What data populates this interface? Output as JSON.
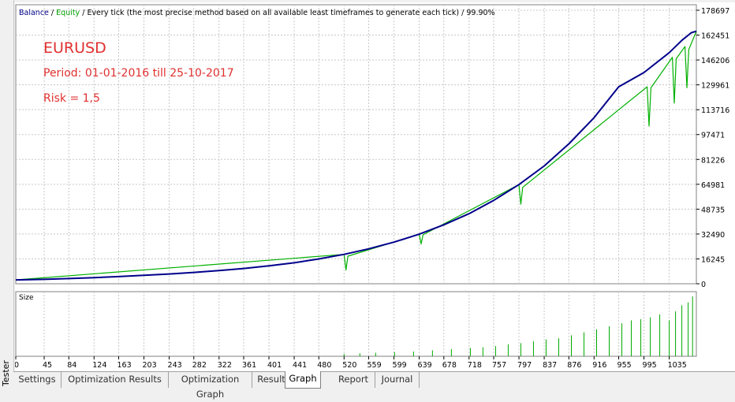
{
  "side_panel": {
    "label": "Tester"
  },
  "header": {
    "balance": "Balance",
    "sep1": " / ",
    "equity": "Equity",
    "sep2": " / ",
    "description": "Every tick (the most precise method based on all available least timeframes to generate each tick)",
    "sep3": " / ",
    "quality": "99.90%"
  },
  "annotations": {
    "symbol": "EURUSD",
    "period": "Period: 01-01-2016  till  25-10-2017",
    "risk": "Risk = 1,5"
  },
  "size_panel": {
    "label": "Size"
  },
  "tabs": [
    {
      "label": "Settings",
      "active": false
    },
    {
      "label": "Optimization Results",
      "active": false
    },
    {
      "label": "Optimization Graph",
      "active": false
    },
    {
      "label": "Results",
      "active": false
    },
    {
      "label": "Graph",
      "active": true
    },
    {
      "label": "Report",
      "active": false
    },
    {
      "label": "Journal",
      "active": false
    }
  ],
  "colors": {
    "balance": "#00008b",
    "equity": "#00b000",
    "annotation": "#e03030",
    "grid": "#c8c8c8",
    "size_bars": "#00aa00"
  },
  "chart_data": {
    "type": "line",
    "title": "",
    "xlabel": "",
    "ylabel": "",
    "x_ticks": [
      0,
      45,
      84,
      124,
      163,
      203,
      243,
      282,
      322,
      361,
      401,
      441,
      480,
      520,
      559,
      599,
      639,
      678,
      718,
      757,
      797,
      837,
      876,
      916,
      955,
      995,
      1035
    ],
    "y_ticks": [
      0,
      16245,
      32490,
      48735,
      64981,
      81226,
      97471,
      113716,
      129961,
      146206,
      162451,
      178697
    ],
    "xlim": [
      0,
      1078
    ],
    "ylim": [
      0,
      178697
    ],
    "grid": true,
    "series": [
      {
        "name": "Balance",
        "x": [
          0,
          45,
          84,
          124,
          163,
          203,
          243,
          282,
          322,
          361,
          401,
          441,
          480,
          520,
          559,
          599,
          639,
          678,
          718,
          757,
          797,
          837,
          876,
          916,
          955,
          995,
          1035,
          1055,
          1070,
          1078
        ],
        "values": [
          2500,
          2900,
          3400,
          4000,
          4700,
          5500,
          6400,
          7400,
          8600,
          10000,
          11700,
          13700,
          16200,
          19200,
          22800,
          27200,
          32400,
          38500,
          45800,
          54500,
          64800,
          77000,
          91400,
          108500,
          128700,
          138000,
          151000,
          159000,
          164000,
          165000
        ]
      },
      {
        "name": "Equity",
        "x": [
          0,
          520,
          523,
          526,
          639,
          642,
          645,
          797,
          800,
          803,
          1000,
          1003,
          1006,
          1040,
          1043,
          1046,
          1060,
          1063,
          1066,
          1078
        ],
        "values": [
          2500,
          19200,
          9000,
          18000,
          32400,
          26000,
          32000,
          64800,
          52000,
          63000,
          128700,
          103000,
          128000,
          148000,
          118000,
          147000,
          155000,
          128000,
          153000,
          165000
        ]
      }
    ],
    "size_series": {
      "name": "Size",
      "x": [
        520,
        545,
        570,
        600,
        630,
        660,
        690,
        720,
        740,
        760,
        780,
        800,
        820,
        840,
        860,
        880,
        900,
        920,
        940,
        960,
        975,
        990,
        1005,
        1020,
        1035,
        1045,
        1055,
        1065,
        1072
      ],
      "values": [
        0.04,
        0.05,
        0.06,
        0.07,
        0.08,
        0.1,
        0.12,
        0.14,
        0.15,
        0.17,
        0.2,
        0.22,
        0.25,
        0.28,
        0.3,
        0.35,
        0.4,
        0.45,
        0.5,
        0.55,
        0.6,
        0.62,
        0.65,
        0.7,
        0.6,
        0.75,
        0.85,
        0.9,
        1.0
      ]
    }
  }
}
